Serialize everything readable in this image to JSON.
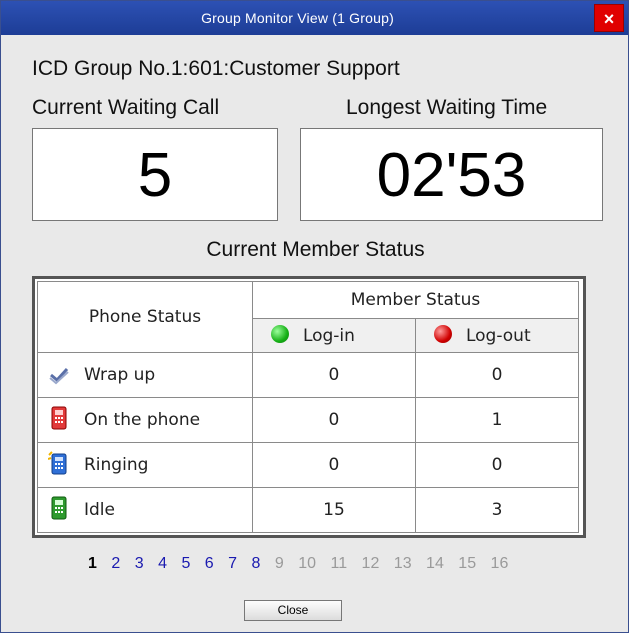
{
  "window": {
    "title": "Group Monitor View (1 Group)",
    "close_glyph": "×"
  },
  "group_title": "ICD Group No.1:601:Customer Support",
  "waiting": {
    "label": "Current Waiting Call",
    "value": "5"
  },
  "longest": {
    "label": "Longest Waiting Time",
    "value": "02'53"
  },
  "member_status_title": "Current Member Status",
  "table": {
    "phone_status_header": "Phone Status",
    "member_status_header": "Member Status",
    "login_header": "Log-in",
    "logout_header": "Log-out",
    "rows": [
      {
        "icon": "wrap-up-icon",
        "label": "Wrap up",
        "login": "0",
        "logout": "0"
      },
      {
        "icon": "on-the-phone-icon",
        "label": "On the phone",
        "login": "0",
        "logout": "1"
      },
      {
        "icon": "ringing-icon",
        "label": "Ringing",
        "login": "0",
        "logout": "0"
      },
      {
        "icon": "idle-icon",
        "label": "Idle",
        "login": "15",
        "logout": "3"
      }
    ]
  },
  "pager": {
    "pages": [
      "1",
      "2",
      "3",
      "4",
      "5",
      "6",
      "7",
      "8",
      "9",
      "10",
      "11",
      "12",
      "13",
      "14",
      "15",
      "16"
    ],
    "current": "1",
    "enabled_up_to": 8
  },
  "close_button": "Close",
  "colors": {
    "title_bar": "#1d3d96",
    "close_red": "#e00000",
    "login_green": "#16b016",
    "logout_red": "#d00000",
    "page_link": "#1a1ab0"
  }
}
